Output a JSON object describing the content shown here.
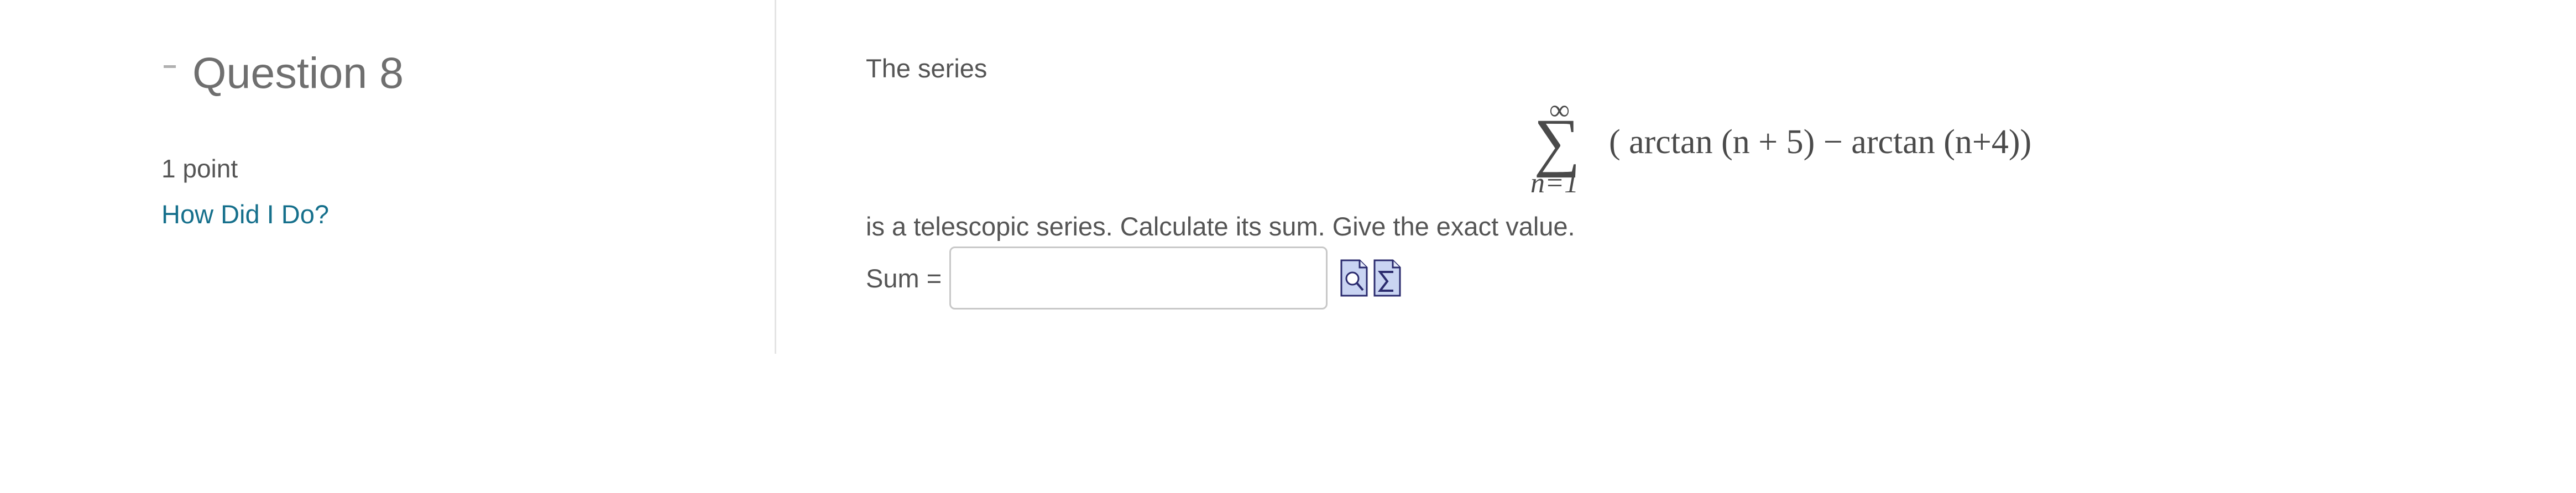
{
  "question": {
    "title": "Question 8",
    "points": "1 point",
    "how_did_link": "How Did I Do?"
  },
  "problem": {
    "lead_text": "The series",
    "sum_upper": "∞",
    "sum_symbol": "∑",
    "sum_lower": "n=1",
    "summand": "( arctan (n + 5) − arctan (n+4))",
    "after_text": "is a telescopic series. Calculate its sum. Give the exact value.",
    "answer_label": "Sum =",
    "answer_value": ""
  },
  "icons": {
    "preview": "magnifier-preview-icon",
    "equation_editor": "sigma-equation-icon"
  },
  "colors": {
    "link": "#16708c",
    "icon_fill": "#c9d4f2",
    "icon_stroke": "#2b2b6e"
  }
}
